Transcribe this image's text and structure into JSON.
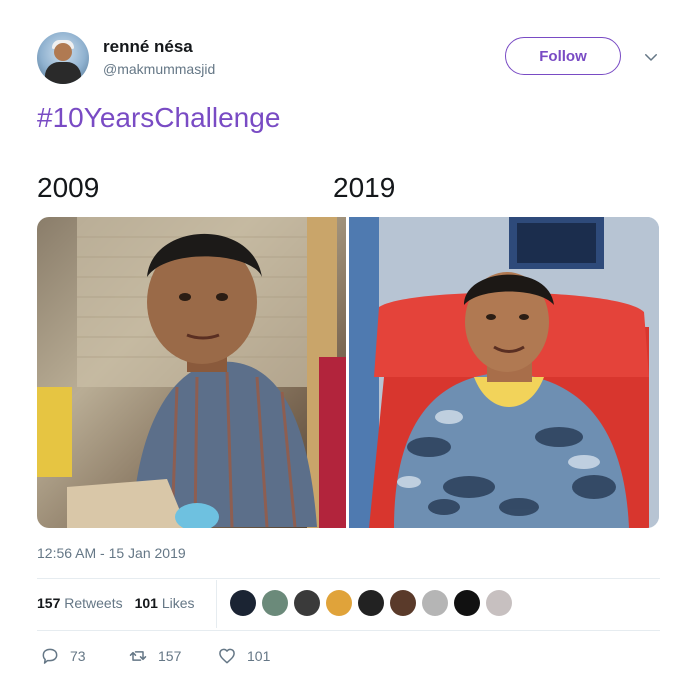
{
  "user": {
    "name": "renné nésa",
    "handle": "@makmummasjid"
  },
  "follow_label": "Follow",
  "hashtag": "#10YearsChallenge",
  "photos": {
    "left_year": "2009",
    "right_year": "2019"
  },
  "timestamp": "12:56 AM - 15 Jan 2019",
  "stats": {
    "retweets_count": "157",
    "retweets_label": "Retweets",
    "likes_count": "101",
    "likes_label": "Likes"
  },
  "liker_colors": [
    "#1b2433",
    "#6b8a7a",
    "#3a3a3a",
    "#e0a33a",
    "#222222",
    "#5a3a2a",
    "#b5b5b5",
    "#111111",
    "#c7c0c0"
  ],
  "actions": {
    "reply_count": "73",
    "retweet_count": "157",
    "like_count": "101"
  },
  "colors": {
    "accent": "#794bc4",
    "text_secondary": "#657786"
  },
  "icons": {
    "reply": "reply-icon",
    "retweet": "retweet-icon",
    "like": "heart-icon",
    "chevron": "chevron-down-icon"
  }
}
